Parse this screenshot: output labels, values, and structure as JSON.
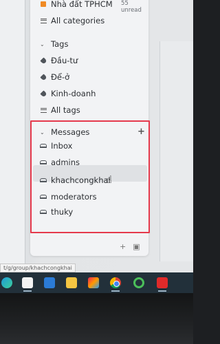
{
  "sidebar": {
    "top_item": {
      "label": "Nhà đất TPHCM",
      "unread": "55 unread"
    },
    "all_categories": "All categories",
    "tags": {
      "title": "Tags",
      "items": [
        {
          "label": "Đầu-tư"
        },
        {
          "label": "Để-ở"
        },
        {
          "label": "Kinh-doanh"
        }
      ],
      "all_tags": "All tags"
    },
    "messages": {
      "title": "Messages",
      "items": [
        {
          "label": "Inbox"
        },
        {
          "label": "admins"
        },
        {
          "label": "khachcongkhai"
        },
        {
          "label": "moderators"
        },
        {
          "label": "thuky"
        }
      ]
    }
  },
  "status_url": "t/g/group/khachcongkhai",
  "colors": {
    "highlight_box": "#e5394c",
    "category_square": "#f08a24",
    "taskbar": "#22303a"
  },
  "taskbar": {
    "icons": [
      "edge-icon",
      "store-icon",
      "mail-icon",
      "file-explorer-icon",
      "paint-icon",
      "chrome-icon",
      "green-app-icon",
      "anydesk-icon"
    ]
  }
}
